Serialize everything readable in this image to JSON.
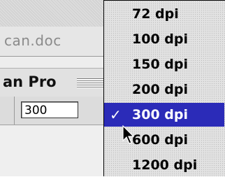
{
  "document": {
    "title_fragment": "can.doc",
    "toolbar_label": "an Pro",
    "resolution_value": "300"
  },
  "menu": {
    "items": [
      {
        "label": "72 dpi",
        "selected": false
      },
      {
        "label": "100 dpi",
        "selected": false
      },
      {
        "label": "150 dpi",
        "selected": false
      },
      {
        "label": "200 dpi",
        "selected": false
      },
      {
        "label": "300 dpi",
        "selected": true
      },
      {
        "label": "600 dpi",
        "selected": false
      },
      {
        "label": "1200 dpi",
        "selected": false
      }
    ],
    "checkmark": "✓",
    "highlight_color": "#2b2bb8"
  },
  "cursor": {
    "icon": "arrow-pointer-icon"
  }
}
